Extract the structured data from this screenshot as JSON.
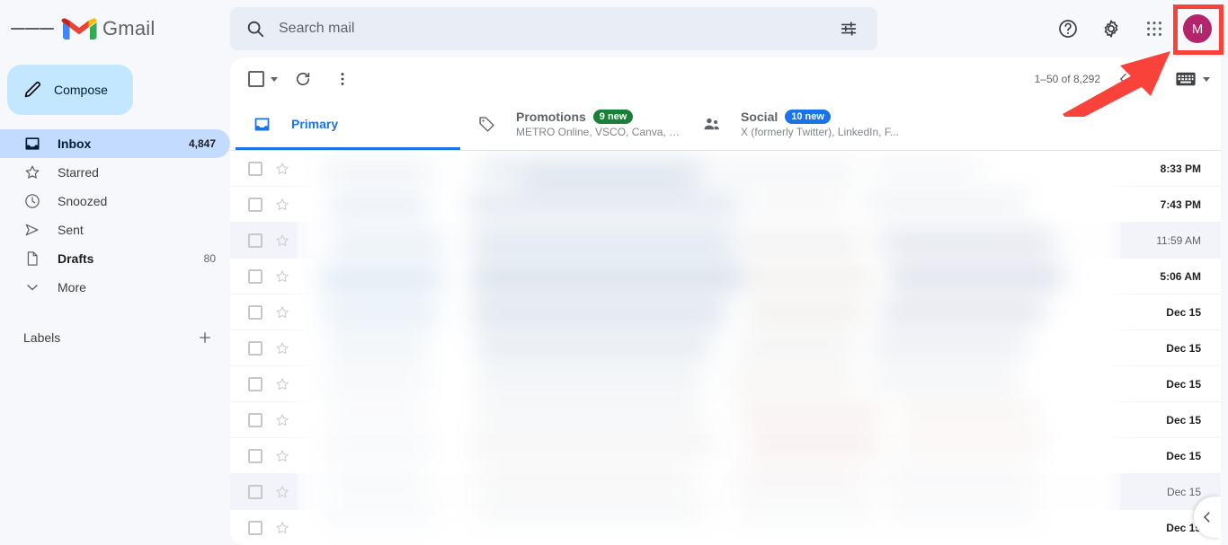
{
  "app": {
    "name": "Gmail",
    "background_color": "#f6f8fc",
    "accent_color": "#1a73e8"
  },
  "header": {
    "menu_icon": "hamburger-menu-icon",
    "logo_icon": "gmail-logo-icon",
    "brand_label": "Gmail",
    "help_icon": "help-circle-icon",
    "settings_icon": "gear-icon",
    "apps_icon": "apps-grid-icon",
    "avatar_letter": "M",
    "avatar_color": "#b4246b"
  },
  "search": {
    "icon": "search-icon",
    "placeholder": "Search mail",
    "value": "",
    "options_icon": "search-options-icon"
  },
  "sidebar": {
    "compose": {
      "label": "Compose",
      "icon": "pencil-icon",
      "color": "#c2e7ff"
    },
    "items": [
      {
        "label": "Inbox",
        "count": "4,847",
        "icon": "inbox-icon",
        "state": "active"
      },
      {
        "label": "Starred",
        "count": "",
        "icon": "star-icon",
        "state": "plain"
      },
      {
        "label": "Snoozed",
        "count": "",
        "icon": "clock-icon",
        "state": "plain"
      },
      {
        "label": "Sent",
        "count": "",
        "icon": "send-icon",
        "state": "plain"
      },
      {
        "label": "Drafts",
        "count": "80",
        "icon": "draft-icon",
        "state": "bold"
      },
      {
        "label": "More",
        "count": "",
        "icon": "chevron-down-icon",
        "state": "plain"
      }
    ],
    "labels": {
      "title": "Labels",
      "add_icon": "plus-icon"
    }
  },
  "toolbar": {
    "select_all_checkbox": "select-all-checkbox",
    "select_caret_icon": "chevron-down-icon",
    "refresh_icon": "refresh-icon",
    "more_icon": "more-vertical-icon",
    "pager_range": "1–50 of 8,292",
    "prev_icon": "chevron-left-icon",
    "next_icon": "chevron-right-icon",
    "input_tools_icon": "keyboard-icon",
    "input_tools_caret_icon": "chevron-down-icon"
  },
  "tabs": [
    {
      "label": "Primary",
      "icon": "inbox-tab-icon",
      "badge": "",
      "badge_color": "",
      "subtitle": "",
      "active": true
    },
    {
      "label": "Promotions",
      "icon": "tag-icon",
      "badge": "9 new",
      "badge_color": "#188038",
      "subtitle": "METRO Online, VSCO, Canva, M...",
      "active": false
    },
    {
      "label": "Social",
      "icon": "people-icon",
      "badge": "10 new",
      "badge_color": "#1a73e8",
      "subtitle": "X (formerly Twitter), LinkedIn, F...",
      "active": false
    }
  ],
  "email_list": {
    "checkbox_icon": "row-checkbox",
    "star_icon": "star-outline-icon",
    "content_state": "blurred",
    "rows": [
      {
        "date": "8:33 PM",
        "read": false
      },
      {
        "date": "7:43 PM",
        "read": false
      },
      {
        "date": "11:59 AM",
        "read": true
      },
      {
        "date": "5:06 AM",
        "read": false
      },
      {
        "date": "Dec 15",
        "read": false
      },
      {
        "date": "Dec 15",
        "read": false
      },
      {
        "date": "Dec 15",
        "read": false
      },
      {
        "date": "Dec 15",
        "read": false
      },
      {
        "date": "Dec 15",
        "read": false
      },
      {
        "date": "Dec 15",
        "read": true
      },
      {
        "date": "Dec 15",
        "read": false
      }
    ]
  },
  "edge_panel": {
    "toggle_icon": "chevron-left-icon"
  },
  "annotation": {
    "highlight_target": "account-avatar",
    "box_color": "#f9423a",
    "arrow_color": "#f9423a"
  }
}
